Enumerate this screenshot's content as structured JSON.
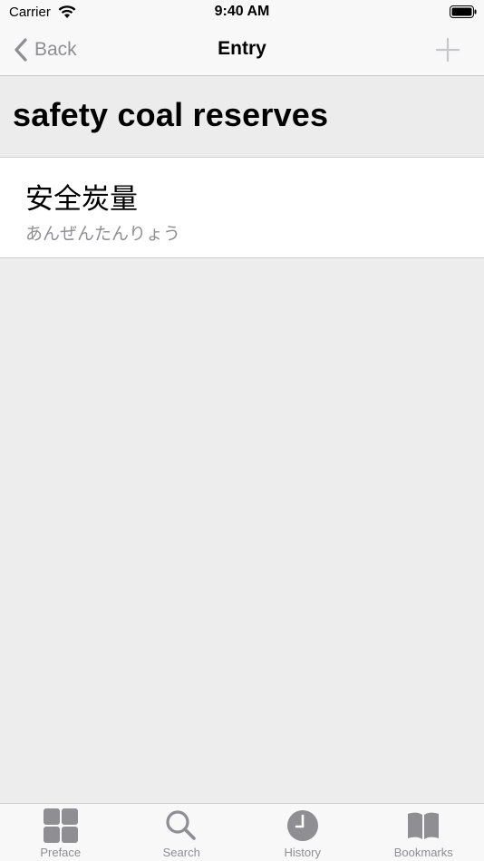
{
  "status_bar": {
    "carrier": "Carrier",
    "time": "9:40 AM"
  },
  "nav": {
    "back_label": "Back",
    "title": "Entry"
  },
  "entry": {
    "heading": "safety coal reserves",
    "kanji": "安全炭量",
    "reading": "あんぜんたんりょう"
  },
  "tab_bar": {
    "items": [
      {
        "label": "Preface",
        "icon": "grid-icon"
      },
      {
        "label": "Search",
        "icon": "search-icon"
      },
      {
        "label": "History",
        "icon": "clock-icon"
      },
      {
        "label": "Bookmarks",
        "icon": "book-icon"
      }
    ]
  },
  "colors": {
    "background": "#ededed",
    "bar": "#f8f8f8",
    "gray_text": "#8e8e93",
    "icon_gray": "#8e8e93"
  }
}
